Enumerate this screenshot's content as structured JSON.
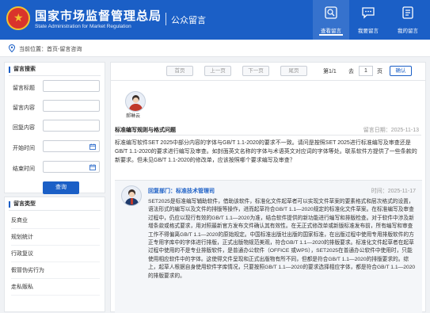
{
  "header": {
    "title_cn": "国家市场监督管理总局",
    "title_en": "State Administration for Market Regulation",
    "subtitle": "公众留言",
    "nav": [
      {
        "label": "查看留言",
        "icon": "view-message-icon"
      },
      {
        "label": "我要留言",
        "icon": "write-message-icon"
      },
      {
        "label": "我的留言",
        "icon": "my-message-icon"
      }
    ]
  },
  "breadcrumb": {
    "text": "当前位置：首页-留言咨询"
  },
  "search": {
    "title": "留言搜索",
    "fields": [
      "留言标题",
      "留言内容",
      "回复内容",
      "开始时间",
      "结束时间"
    ],
    "query_label": "查询"
  },
  "types": {
    "title": "留言类型",
    "items": [
      "反商业",
      "规划统计",
      "行政复议",
      "假冒伪劣行为",
      "走私贩私"
    ]
  },
  "pager": {
    "first": "首页",
    "prev": "上一页",
    "next": "下一页",
    "last": "尾页",
    "page_info": "第1/1",
    "goto_prefix": "去",
    "page_value": "1",
    "page_suffix": "页",
    "confirm": "确认"
  },
  "message": {
    "user_name": "郝琳云",
    "title": "标准编写规则与格式问题",
    "date": "留言日期：2025-11-13",
    "body": "标准编写软件SET 2025中部分内容的字体与GB/T 1.1-2020的要求不一致。请问是按照SET 2025进行标准编写及审查还是GB/T 1.1-2020的要求进行编写及审查。如封面英文名称的字体与术语英文对应词的字体等处。联系软件方提供了一些条款的新要求。但未见GB/T 1.1-2020的修改单，应该按照哪个要求编写及审查？"
  },
  "reply": {
    "dept": "回复部门：标准技术管理司",
    "time": "时间：2025-11-17",
    "body": "SET2025是标准编写辅助软件，借助该软件，标准化文件起草者可以实现文件草案的要素格式和层次格式的设置，语法形式的编写以及文件的排版等操作，进而起草符合GB/T 1.1—2020规定的标准化文件草案。在标准编写及审查过程中，仍应以现行有效的GB/T 1.1—2020为准，结合软件提供的新功能进行编写和排版检查。对于软件中涉及新增条款或格式要求，用对照最新官方发布文件确认其有效性。在无正式修改单或新版标准发布前，所有编写和审查工作不得偏离GB/T 1.1—2020的原始规定。中国标准出版社出版的国家标准，在出版过程中使用专用排版软件的方正专用字库中的字体进行排版，正式出版物规范美观，符合GB/T 1.1—2020的排版要求。标准化文件起草者在起草过程中使用的不是专业排版软件，是普通办公软件（OFFICE 或WPS），SET2025在普通办公软件中使用时，只能使用相应软件中的字体。这使得文件呈现和正式出版物有所不同，但都是符合GB/T 1.1—2020的排版要求的。综上，起草人根据自身使用软件字库情况，只要按照GB/T 1.1—2020的要求选择相应字体，都是符合GB/T 1.1—2020的排版要求的。"
  }
}
